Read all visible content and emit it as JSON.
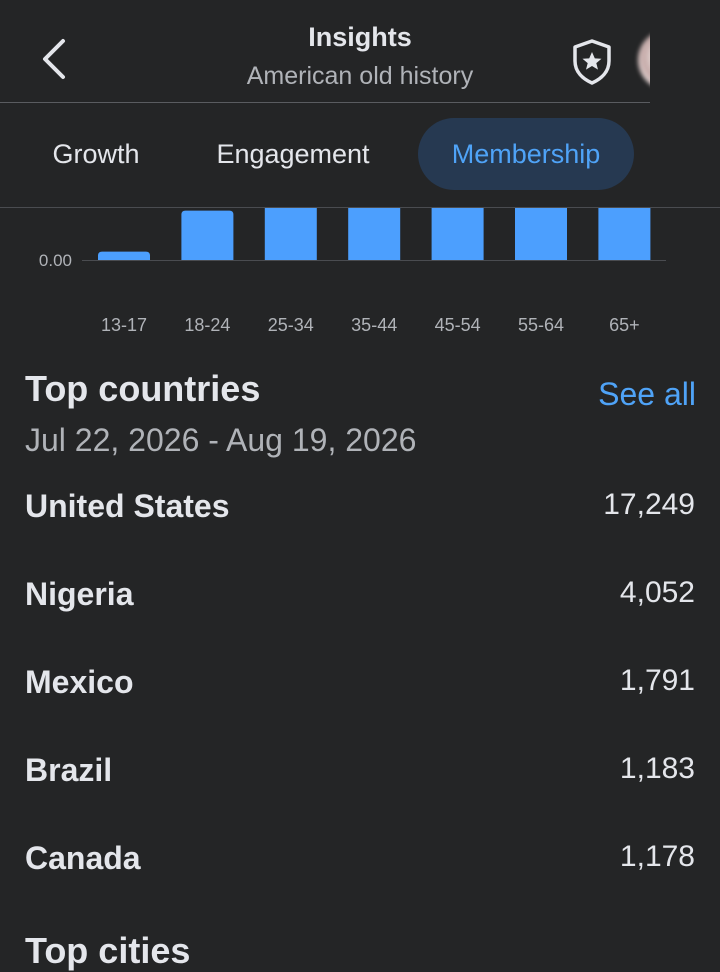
{
  "header": {
    "title": "Insights",
    "subtitle": "American old history",
    "back_icon": "arrow-left-icon",
    "shield_icon": "shield-star-icon"
  },
  "tabs": [
    {
      "label": "Growth",
      "active": false
    },
    {
      "label": "Engagement",
      "active": false
    },
    {
      "label": "Membership",
      "active": true
    }
  ],
  "chart_data": {
    "type": "bar",
    "categories": [
      "13-17",
      "18-24",
      "25-34",
      "35-44",
      "45-54",
      "55-64",
      "65+"
    ],
    "series": [
      {
        "values": [
          0.08,
          0.47,
          1.0,
          1.0,
          1.0,
          1.0,
          1.0
        ]
      }
    ],
    "y_tick_labels": [
      "0.00"
    ],
    "bar_color": "#4c9ffe"
  },
  "top_countries": {
    "title": "Top countries",
    "see_all": "See all",
    "date_range": "Jul 22, 2026 - Aug 19, 2026",
    "rows": [
      {
        "name": "United States",
        "value": "17,249"
      },
      {
        "name": "Nigeria",
        "value": "4,052"
      },
      {
        "name": "Mexico",
        "value": "1,791"
      },
      {
        "name": "Brazil",
        "value": "1,183"
      },
      {
        "name": "Canada",
        "value": "1,178"
      }
    ]
  },
  "next_section": {
    "title": "Top cities"
  },
  "colors": {
    "background": "#242526",
    "accent": "#4fa3f7",
    "active_tab_bg": "#263951"
  }
}
